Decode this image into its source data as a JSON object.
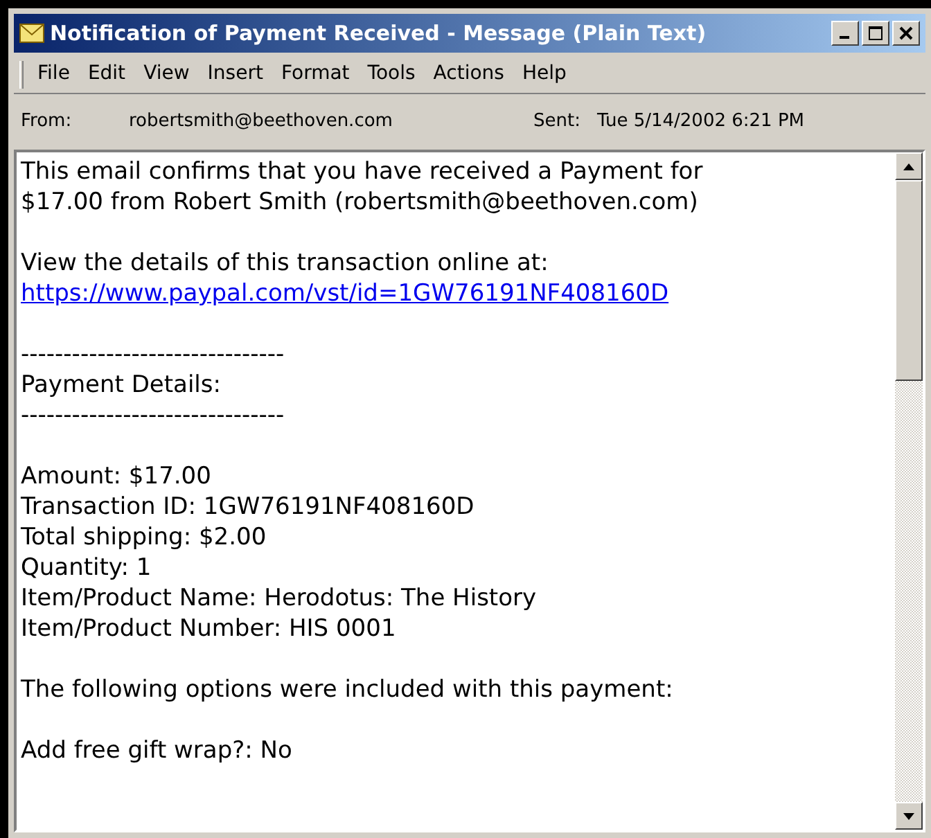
{
  "window": {
    "title": "Notification of Payment Received - Message (Plain Text)"
  },
  "menu": [
    "File",
    "Edit",
    "View",
    "Insert",
    "Format",
    "Tools",
    "Actions",
    "Help"
  ],
  "header": {
    "from_label": "From:",
    "from": "robertsmith@beethoven.com",
    "sent_label": "Sent:",
    "sent": "Tue 5/14/2002 6:21 PM"
  },
  "body": [
    {
      "kind": "text",
      "text": "This email confirms that you have received a Payment for"
    },
    {
      "kind": "text",
      "text": "$17.00 from Robert Smith (robertsmith@beethoven.com)"
    },
    {
      "kind": "blank"
    },
    {
      "kind": "text",
      "text": "View the details of this transaction online at:"
    },
    {
      "kind": "link",
      "text": "https://www.paypal.com/vst/id=1GW76191NF408160D"
    },
    {
      "kind": "blank"
    },
    {
      "kind": "text",
      "text": "-------------------------------"
    },
    {
      "kind": "text",
      "text": "Payment Details:"
    },
    {
      "kind": "text",
      "text": "-------------------------------"
    },
    {
      "kind": "blank"
    },
    {
      "kind": "text",
      "text": "Amount: $17.00"
    },
    {
      "kind": "text",
      "text": "Transaction ID: 1GW76191NF408160D"
    },
    {
      "kind": "text",
      "text": "Total shipping: $2.00"
    },
    {
      "kind": "text",
      "text": "Quantity: 1"
    },
    {
      "kind": "text",
      "text": "Item/Product Name: Herodotus: The History"
    },
    {
      "kind": "text",
      "text": "Item/Product Number: HIS 0001"
    },
    {
      "kind": "blank"
    },
    {
      "kind": "text",
      "text": "The following options were included with this payment:"
    },
    {
      "kind": "blank"
    },
    {
      "kind": "text",
      "text": "Add free gift wrap?: No"
    }
  ]
}
